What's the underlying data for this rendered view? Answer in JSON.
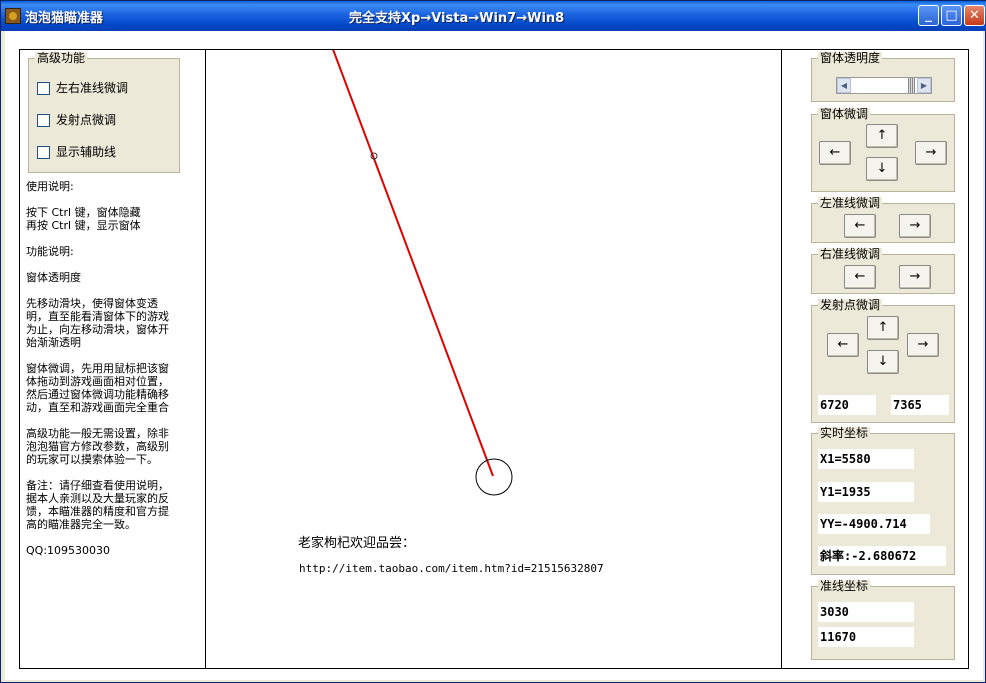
{
  "window": {
    "title": "泡泡猫瞄准器",
    "subtitle": "完全支持Xp→Vista→Win7→Win8",
    "minimize_label": "_",
    "maximize_label": "□",
    "close_label": "✕"
  },
  "left": {
    "advanced_group_title": "高级功能",
    "checkboxes": [
      {
        "label": "左右准线微调",
        "checked": false
      },
      {
        "label": "发射点微调",
        "checked": false
      },
      {
        "label": "显示辅助线",
        "checked": false
      }
    ],
    "help_text": "使用说明:\n\n按下 Ctrl 键，窗体隐藏\n再按 Ctrl 键，显示窗体\n\n功能说明:\n\n窗体透明度\n\n先移动滑块，使得窗体变透明，直至能看清窗体下的游戏为止，向左移动滑块，窗体开始渐渐透明\n\n窗体微调，先用用鼠标把该窗体拖动到游戏画面相对位置，然后通过窗体微调功能精确移动，直至和游戏画面完全重合\n\n高级功能一般无需设置，除非泡泡猫官方修改参数，高级别的玩家可以摸索体验一下。\n\n备注：请仔细查看使用说明，据本人亲测以及大量玩家的反馈，本瞄准器的精度和官方提高的瞄准器完全一致。\n\nQQ:109530030"
  },
  "canvas": {
    "promo_text": "老家枸杞欢迎品尝：",
    "promo_url": "http://item.taobao.com/item.htm?id=21515632807",
    "line_color": "#e00000"
  },
  "right": {
    "transparency": {
      "title": "窗体透明度",
      "value_percent": 75
    },
    "window_adjust": {
      "title": "窗体微调",
      "up": "↑",
      "down": "↓",
      "left": "←",
      "right": "→"
    },
    "left_aim": {
      "title": "左准线微调",
      "left": "←",
      "right": "→"
    },
    "right_aim": {
      "title": "右准线微调",
      "left": "←",
      "right": "→"
    },
    "launch_point": {
      "title": "发射点微调",
      "up": "↑",
      "down": "↓",
      "left": "←",
      "right": "→",
      "x": "6720",
      "y": "7365"
    },
    "realtime": {
      "title": "实时坐标",
      "x1": "X1=5580",
      "y1": "Y1=1935",
      "yy": "YY=-4900.714",
      "slope": "斜率:-2.680672"
    },
    "aim_coords": {
      "title": "准线坐标",
      "a": "3030",
      "b": "11670"
    }
  }
}
